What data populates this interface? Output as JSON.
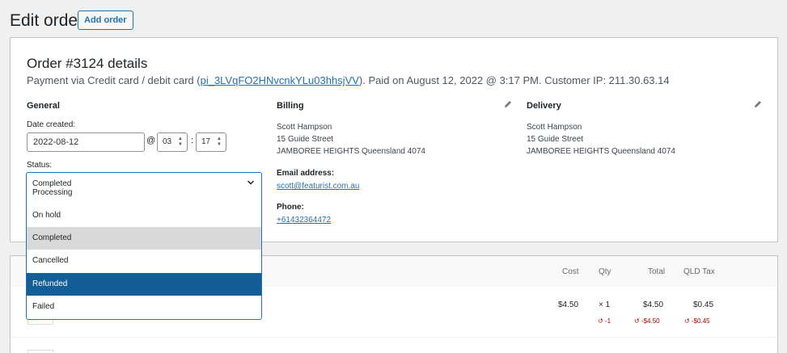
{
  "page": {
    "title": "Edit order",
    "add_order": "Add order"
  },
  "order": {
    "heading": "Order #3124 details",
    "payment_prefix": "Payment via Credit card / debit card (",
    "payment_link": "pi_3LVqFO2HNvcnkYLu03hhsjVV",
    "payment_suffix": "). Paid on August 12, 2022 @ 3:17 PM. Customer IP: 211.30.63.14"
  },
  "general": {
    "heading": "General",
    "date_label": "Date created:",
    "date_value": "2022-08-12",
    "at": "@",
    "hour": "03",
    "colon": ":",
    "minute": "17",
    "status_label": "Status:",
    "status_current": "Completed",
    "status_options": [
      "Processing",
      "On hold",
      "Completed",
      "Cancelled",
      "Refunded",
      "Failed"
    ]
  },
  "billing": {
    "heading": "Billing",
    "name": "Scott Hampson",
    "street": "15 Guide Street",
    "city": "JAMBOREE HEIGHTS Queensland 4074",
    "email_label": "Email address:",
    "email": "scott@featurist.com.au",
    "phone_label": "Phone:",
    "phone": "+61432364472"
  },
  "delivery": {
    "heading": "Delivery",
    "name": "Scott Hampson",
    "street": "15 Guide Street",
    "city": "JAMBOREE HEIGHTS Queensland 4074"
  },
  "items": {
    "columns": [
      "Cost",
      "Qty",
      "Total",
      "QLD Tax"
    ],
    "row": {
      "cost": "$4.50",
      "qty": "× 1",
      "total": "$4.50",
      "tax": "$0.45",
      "refund_qty": "-1",
      "refund_total": "-$4.50",
      "refund_tax": "-$0.45"
    }
  },
  "colors": {
    "accent": "#2271b1",
    "hover": "#135e96",
    "refund": "#aa0000"
  }
}
